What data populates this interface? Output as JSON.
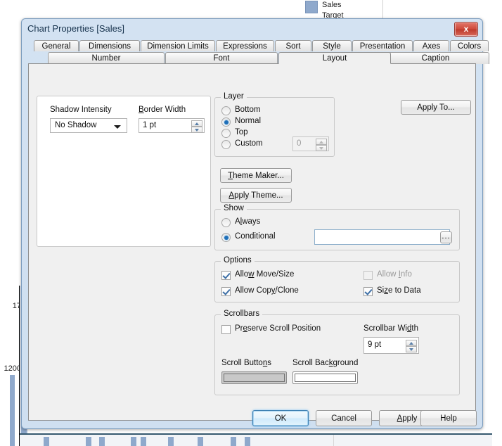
{
  "background": {
    "legend": {
      "series_1": "Sales",
      "series_2": "Target",
      "swatch_color": "#8fa9cc"
    },
    "y_axis_labels": [
      "17",
      "1200"
    ],
    "chart_note": "partially hidden bar chart behind the dialog"
  },
  "dialog": {
    "title": "Chart Properties [Sales]",
    "close_label": "x",
    "tabs_row1": [
      "General",
      "Dimensions",
      "Dimension Limits",
      "Expressions",
      "Sort",
      "Style",
      "Presentation",
      "Axes",
      "Colors"
    ],
    "tabs_row2": [
      "Number",
      "Font",
      "Layout",
      "Caption"
    ],
    "active_tab": "Layout",
    "apply_to_button": "Apply To...",
    "left_panel": {
      "shadow_intensity_label": "Shadow Intensity",
      "shadow_intensity_value": "No Shadow",
      "border_width_label": "Border Width",
      "border_width_value": "1 pt"
    },
    "layer_group": {
      "title": "Layer",
      "options": [
        "Bottom",
        "Normal",
        "Top",
        "Custom"
      ],
      "selected": "Normal",
      "custom_value": "0"
    },
    "theme_buttons": [
      "Theme Maker...",
      "Apply Theme..."
    ],
    "show_group": {
      "title": "Show",
      "options": [
        "Always",
        "Conditional"
      ],
      "selected": "Conditional",
      "conditional_value": "",
      "conditional_browse": "..."
    },
    "options_group": {
      "title": "Options",
      "items": [
        {
          "label": "Allow Move/Size",
          "checked": true,
          "disabled": false
        },
        {
          "label": "Allow Info",
          "checked": false,
          "disabled": true
        },
        {
          "label": "Allow Copy/Clone",
          "checked": true,
          "disabled": false
        },
        {
          "label": "Size to Data",
          "checked": true,
          "disabled": false
        }
      ]
    },
    "scrollbars_group": {
      "title": "Scrollbars",
      "preserve_scroll_position": {
        "label": "Preserve Scroll Position",
        "checked": false
      },
      "scrollbar_width_label": "Scrollbar Width",
      "scrollbar_width_value": "9 pt",
      "scroll_buttons_label": "Scroll Buttons",
      "scroll_buttons_color": "#c8c8c8",
      "scroll_background_label": "Scroll Background",
      "scroll_background_color": "#ffffff"
    },
    "footer_buttons": [
      "OK",
      "Cancel",
      "Apply",
      "Help"
    ],
    "focused_button": "OK"
  }
}
